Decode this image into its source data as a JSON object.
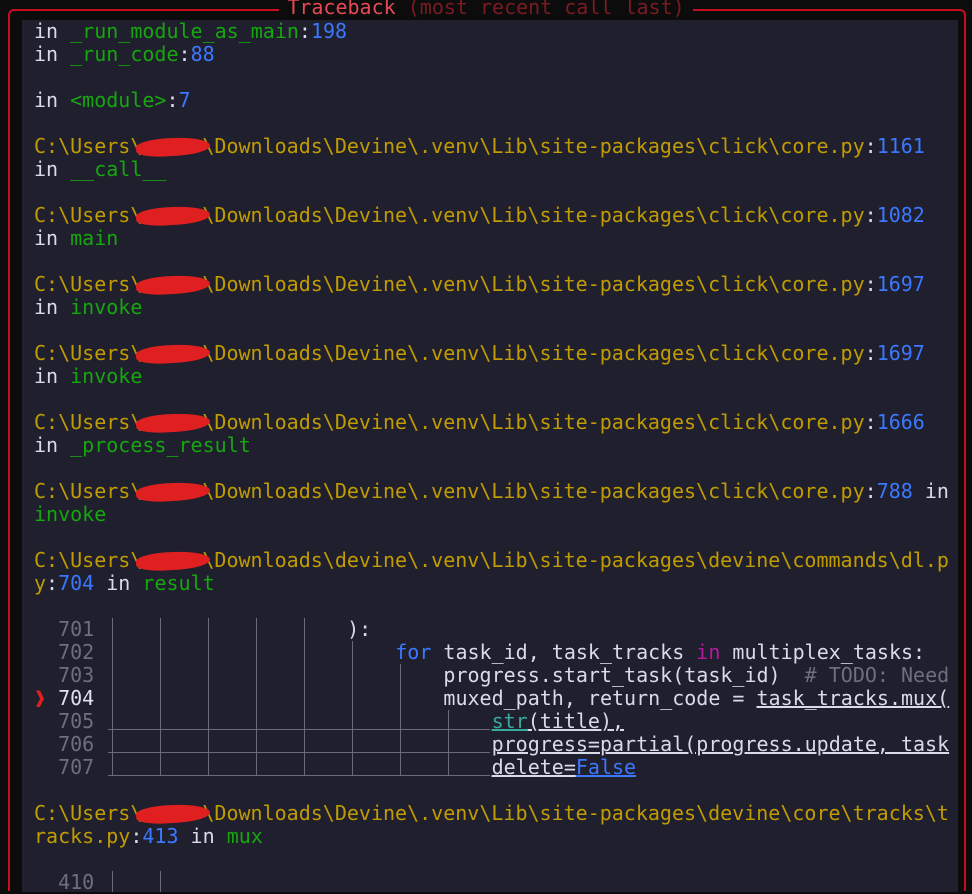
{
  "title": {
    "main": "Traceback",
    "sub": "(most recent call last)"
  },
  "frames_top": [
    {
      "in": "in",
      "func": "_run_module_as_main",
      "sep": ":",
      "lineno": "198"
    },
    {
      "in": "in",
      "func": "_run_code",
      "sep": ":",
      "lineno": "88"
    },
    {
      "in": "in",
      "func": "<module>",
      "sep": ":",
      "lineno": "7"
    }
  ],
  "frames": [
    {
      "prefix": "C:\\Users\\",
      "suffix": "\\Downloads\\Devine\\.venv\\Lib\\site-packages\\click\\core.py",
      "lineno": "1161",
      "in": "in",
      "func": "__call__"
    },
    {
      "prefix": "C:\\Users\\",
      "suffix": "\\Downloads\\Devine\\.venv\\Lib\\site-packages\\click\\core.py",
      "lineno": "1082",
      "in": "in",
      "func": "main"
    },
    {
      "prefix": "C:\\Users\\",
      "suffix": "\\Downloads\\Devine\\.venv\\Lib\\site-packages\\click\\core.py",
      "lineno": "1697",
      "in": "in",
      "func": "invoke"
    },
    {
      "prefix": "C:\\Users\\",
      "suffix": "\\Downloads\\Devine\\.venv\\Lib\\site-packages\\click\\core.py",
      "lineno": "1697",
      "in": "in",
      "func": "invoke"
    },
    {
      "prefix": "C:\\Users\\",
      "suffix": "\\Downloads\\Devine\\.venv\\Lib\\site-packages\\click\\core.py",
      "lineno": "1666",
      "in": "in",
      "func": "_process_result"
    },
    {
      "prefix": "C:\\Users\\",
      "suffix": "\\Downloads\\Devine\\.venv\\Lib\\site-packages\\click\\core.py",
      "lineno": "788",
      "in": "in",
      "func": "invoke"
    },
    {
      "prefix": "C:\\Users\\",
      "suffix": "\\Downloads\\devine\\.venv\\Lib\\site-packages\\devine\\commands\\dl.p",
      "suffix2": "y",
      "lineno": "704",
      "in": "in",
      "func": "result"
    },
    {
      "prefix": "C:\\Users\\",
      "suffix": "\\Downloads\\Devine\\.venv\\Lib\\site-packages\\devine\\core\\tracks\\t",
      "suffix2": "racks.py",
      "lineno": "413",
      "in": "in",
      "func": "mux"
    }
  ],
  "code": {
    "marker": "❱",
    "lines": [
      {
        "no": "701",
        "text": "):"
      },
      {
        "no": "702",
        "kw": "for",
        "a": " task_id, task_tracks ",
        "kin": "in",
        "b": " multiplex_tasks:"
      },
      {
        "no": "703",
        "text": "progress.start_task(task_id)",
        "comment": "  # TODO: Need"
      },
      {
        "no": "704",
        "text": "muxed_path, return_code = ",
        "ul": "task_tracks.mux("
      },
      {
        "no": "705",
        "bi": "str",
        "ul": "(title),"
      },
      {
        "no": "706",
        "ul": "progress=partial(progress.update, task"
      },
      {
        "no": "707",
        "ul": "delete=",
        "kwf": "False"
      }
    ],
    "next_line_no": "410"
  }
}
